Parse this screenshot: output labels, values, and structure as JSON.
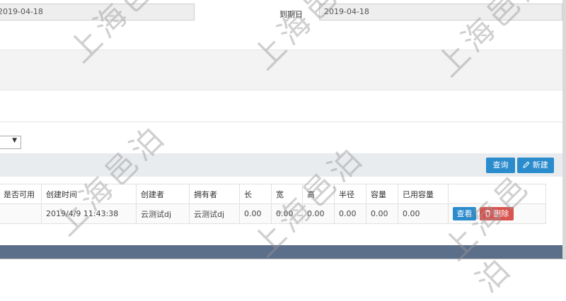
{
  "form": {
    "start_date_value": "2019-04-18",
    "expiry_label": "到期日",
    "expiry_value": "2019-04-18"
  },
  "toolbar": {
    "query_label": "查询",
    "new_label": "新建"
  },
  "table": {
    "headers": [
      "是否可用",
      "创建时间",
      "创建者",
      "拥有者",
      "长",
      "宽",
      "高",
      "半径",
      "容量",
      "已用容量",
      ""
    ],
    "rows": [
      {
        "cells": [
          "",
          "2019/4/9 11:43:38",
          "云测试dj",
          "云测试dj",
          "0.00",
          "0.00",
          "0.00",
          "0.00",
          "0.00",
          "0.00"
        ],
        "view_label": "查看",
        "delete_label": "删除"
      }
    ]
  },
  "watermark": {
    "text": "上海邑泊",
    "color": "#c8c8c8"
  },
  "colors": {
    "accent": "#2a8bcd",
    "danger": "#d9534f",
    "footer": "#5b6e8a"
  },
  "icons": {
    "new": "pencil-icon",
    "delete": "trash-icon",
    "dropdown": "caret-down-icon"
  }
}
